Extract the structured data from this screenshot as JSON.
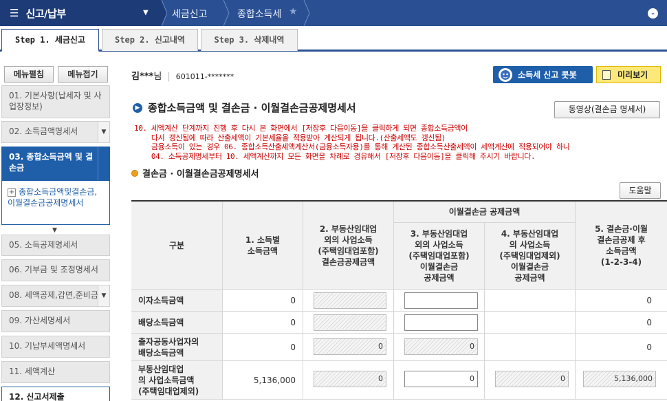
{
  "topbar": {
    "menu_title": "신고/납부",
    "breadcrumb": [
      "세금신고",
      "종합소득세"
    ]
  },
  "tabs": [
    {
      "label": "Step 1. 세금신고",
      "active": true
    },
    {
      "label": "Step 2. 신고내역",
      "active": false
    },
    {
      "label": "Step 3. 삭제내역",
      "active": false
    }
  ],
  "sidebar": {
    "expand_label": "메뉴펼침",
    "collapse_label": "메뉴접기",
    "items": [
      {
        "label": "01. 기본사항(납세자 및 사업장정보)"
      },
      {
        "label": "02. 소득금액명세서"
      },
      {
        "label": "03. 종합소득금액 및 결손금"
      },
      {
        "label": "05. 소득공제명세서"
      },
      {
        "label": "06. 기부금 및 조정명세서"
      },
      {
        "label": "08. 세액공제,감면,준비금"
      },
      {
        "label": "09. 가산세명세서"
      },
      {
        "label": "10. 기납부세액명세서"
      },
      {
        "label": "11. 세액계산"
      },
      {
        "label": "12. 신고서제출"
      }
    ],
    "sub_item": "종합소득금액및결손금,이월결손금공제명세서"
  },
  "user": {
    "name": "김***",
    "honorific": "님",
    "rrn": "601011-*******"
  },
  "buttons": {
    "quick": "소득세 신고 콧봇",
    "preview": "미리보기",
    "video": "동영상(결손금 명세서)",
    "help": "도움말"
  },
  "section_title": "종합소득금액 및 결손금 · 이월결손금공제명세서",
  "notice_lines": [
    "10. 세액계산 단계까지 진행 후 다시 본 화면에서 [저장후 다음이동]을 클릭하게 되면 종합소득금액이",
    "    다시 갱신됨에 따라 산출세액이 기본세율을 적용받아 계산되게 됩니다.(산출세액도 갱신됨)",
    "    금융소득이 있는 경우 06. 종합소득산출세액계산서(금융소득자용)를 통해 계산된 종합소득산출세액이 세액계산에 적용되어야 하니",
    "    04. 소득공제명세부터 10. 세액계산까지 모든 화면을 차례로 경유해서 [저장후 다음이동]을 클릭해 주시기 바랍니다."
  ],
  "sub_title": "결손금 · 이월결손금공제명세서",
  "table": {
    "headers": {
      "category": "구분",
      "col1": "1. 소득별\n소득금액",
      "col2": "2. 부동산임대업\n외의 사업소득\n(주택임대업포함)\n결손금공제금액",
      "group": "이월결손금 공제금액",
      "col3": "3. 부동산임대업\n외의 사업소득\n(주택임대업포함)\n이월결손금\n공제금액",
      "col4": "4. 부동산임대업\n의 사업소득\n(주택임대업제외)\n이월결손금\n공제금액",
      "col5": "5. 결손금·이월\n결손금공제 후\n소득금액\n(1-2-3-4)"
    },
    "rows": [
      {
        "label": "이자소득금액",
        "c1": "0",
        "c2": "",
        "c3": "",
        "c4": "",
        "c5": "0"
      },
      {
        "label": "배당소득금액",
        "c1": "0",
        "c2": "",
        "c3": "",
        "c4": "",
        "c5": "0"
      },
      {
        "label": "출자공동사업자의\n배당소득금액",
        "c1": "0",
        "c2": "0",
        "c3": "0",
        "c4": "",
        "c5": "0"
      },
      {
        "label": "부동산임대업\n의 사업소득금액\n(주택임대업제외)",
        "c1": "5,136,000",
        "c2": "0",
        "c3": "0",
        "c4": "0",
        "c5": "5,136,000"
      }
    ]
  }
}
